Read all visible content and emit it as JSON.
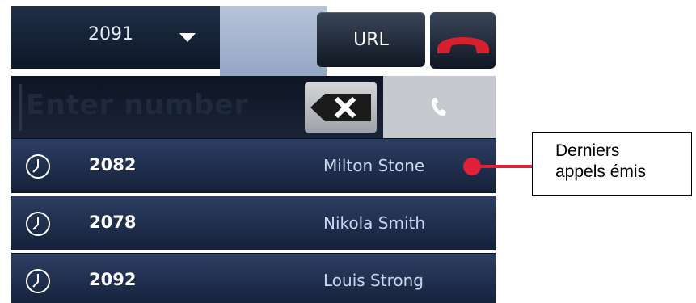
{
  "header": {
    "line_value": "2091",
    "url_label": "URL",
    "hangup_icon": "hangup-icon"
  },
  "dial": {
    "placeholder": "Enter number",
    "backspace_icon": "backspace-icon",
    "call_icon": "phone-icon"
  },
  "recent_calls": [
    {
      "number": "2082",
      "name": "Milton Stone",
      "icon": "clock-icon"
    },
    {
      "number": "2078",
      "name": "Nikola Smith",
      "icon": "clock-icon"
    },
    {
      "number": "2092",
      "name": "Louis Strong",
      "icon": "clock-icon"
    }
  ],
  "callout": {
    "line1": "Derniers",
    "line2": "appels émis"
  },
  "colors": {
    "accent_red": "#e0213a",
    "row_bg": "#1f2f4f"
  }
}
